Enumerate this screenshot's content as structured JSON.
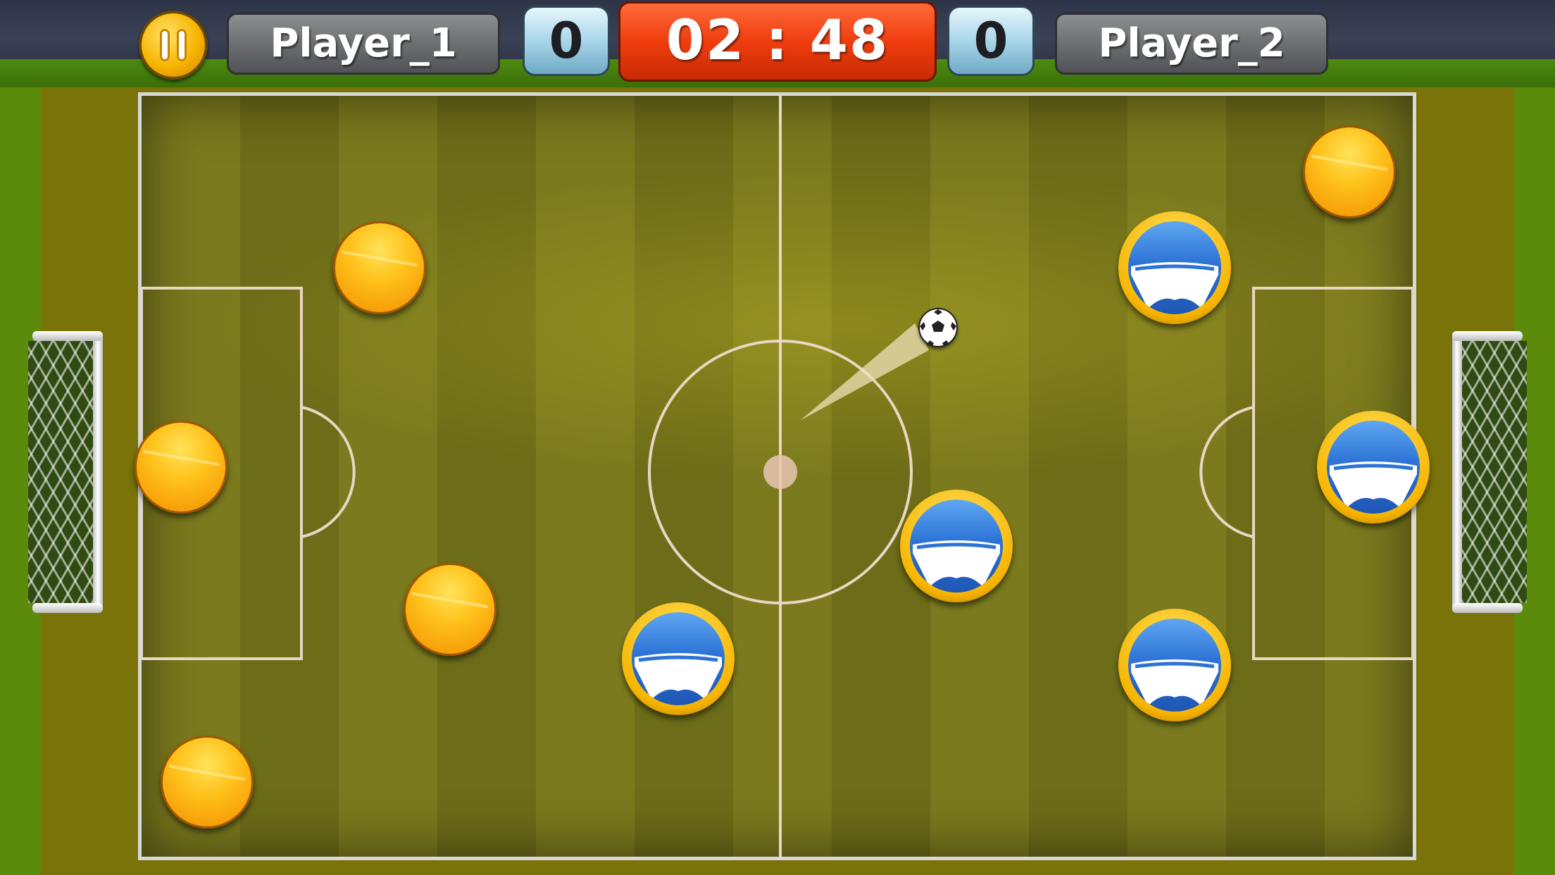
{
  "hud": {
    "player1_name": "Player_1",
    "player2_name": "Player_2",
    "player1_score": "0",
    "player2_score": "0",
    "timer": "02 : 48"
  },
  "icons": {
    "pause": "pause-icon",
    "ball": "soccer-ball-icon",
    "jersey": "shorts-icon"
  },
  "colors": {
    "timer_bg": "#f03d0f",
    "team1": "#f7a21b",
    "team2": "#2d73d6",
    "pitch": "#7b7a1e"
  }
}
